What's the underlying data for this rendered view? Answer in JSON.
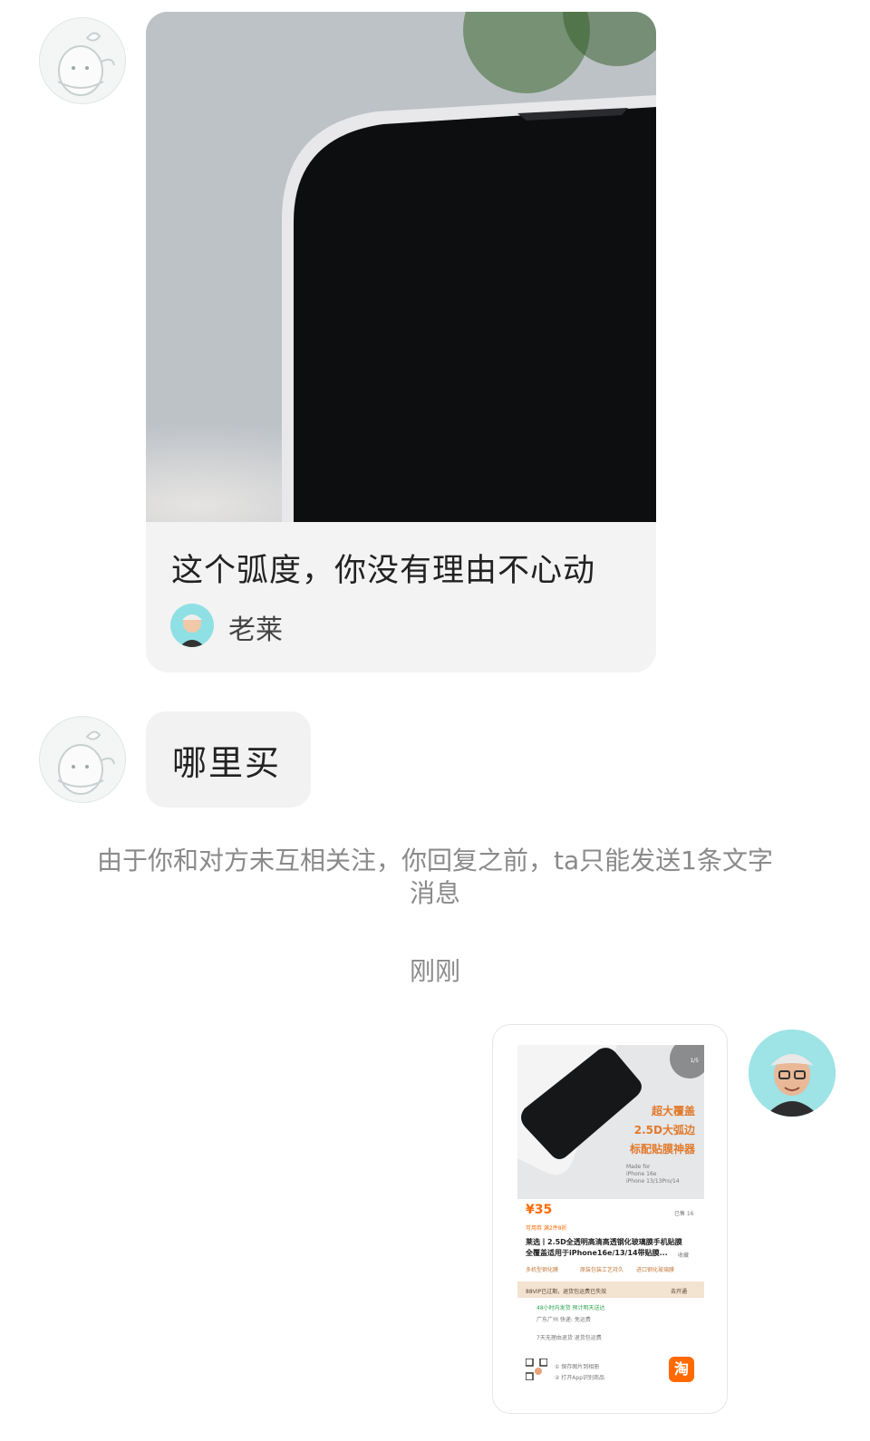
{
  "card": {
    "title": "这个弧度，你没有理由不心动",
    "author": "老莱"
  },
  "bubble": {
    "text": "哪里买"
  },
  "notice": {
    "text": "由于你和对方未互相关注，你回复之前，ta只能发送1条文字消息"
  },
  "timestamp": {
    "text": "刚刚"
  },
  "product": {
    "page_indicator": "1/5",
    "promo_lines": [
      "超大覆盖",
      "2.5D大弧边",
      "标配贴膜神器"
    ],
    "made_for": [
      "Made for",
      "iPhone 16e",
      "iPhone 13/13Pro/14"
    ],
    "price": "¥35",
    "sold": "已售 16",
    "discount": "可用券   满2件8折",
    "title_line1": "莱选丨2.5D全透明高清高透钢化玻璃膜手机贴膜",
    "title_line2": "全覆盖适用于iPhone16e/13/14带贴膜...",
    "collect": "收藏",
    "tags": [
      "多机型钢化膜",
      "原装包装工艺持久",
      "进口钢化玻璃膜"
    ],
    "vip_text": "88VIP已过期，退货包运费已失效",
    "vip_action": "去开通",
    "ship_line1": "48小时内发货   预计明天送达",
    "ship_line2": "广东广州   快递: 免运费",
    "guarantee": "7天无理由退货   退货包运费",
    "hint1": "① 保存图片到相册",
    "hint2": "② 打开App识别商品",
    "taobao_icon": "淘"
  },
  "colors": {
    "accent_orange": "#ff6a00",
    "notice_gray": "#8a8a8a",
    "bubble_bg": "#f2f2f2"
  }
}
